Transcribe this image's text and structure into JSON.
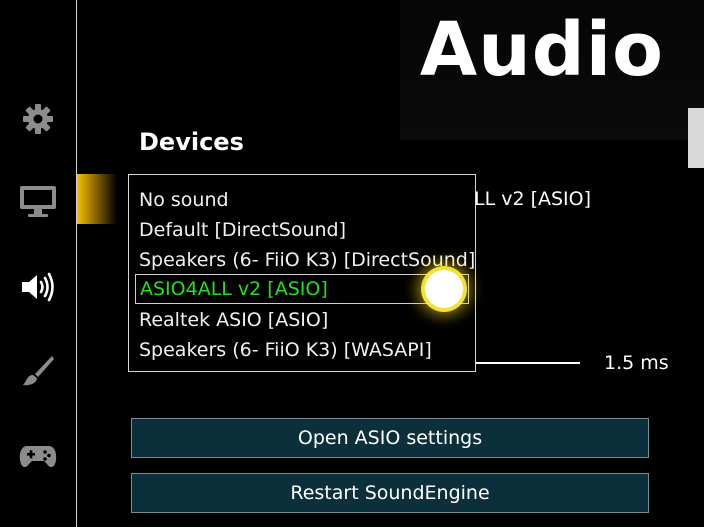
{
  "page": {
    "title": "Audio"
  },
  "sidebar": {
    "items": [
      {
        "name": "settings",
        "icon": "gear-icon"
      },
      {
        "name": "display",
        "icon": "monitor-icon"
      },
      {
        "name": "audio",
        "icon": "speaker-icon",
        "active": true
      },
      {
        "name": "skin",
        "icon": "paintbrush-icon"
      },
      {
        "name": "input",
        "icon": "gamepad-icon"
      }
    ],
    "active_indicator_color": "#f5c000"
  },
  "devices": {
    "heading": "Devices",
    "selected_value_partial": "LL v2 [ASIO]"
  },
  "dropdown": {
    "options": [
      {
        "label": "No sound"
      },
      {
        "label": "Default [DirectSound]"
      },
      {
        "label": "Speakers (6- FiiO K3) [DirectSound]"
      },
      {
        "label": "ASIO4ALL v2 [ASIO]",
        "selected": true
      },
      {
        "label": "Realtek ASIO [ASIO]"
      },
      {
        "label": "Speakers (6- FiiO K3) [WASAPI]"
      }
    ],
    "selected_color": "#22e01a"
  },
  "latency": {
    "value": "1.5 ms"
  },
  "buttons": {
    "open_asio": "Open ASIO settings",
    "restart": "Restart SoundEngine"
  }
}
